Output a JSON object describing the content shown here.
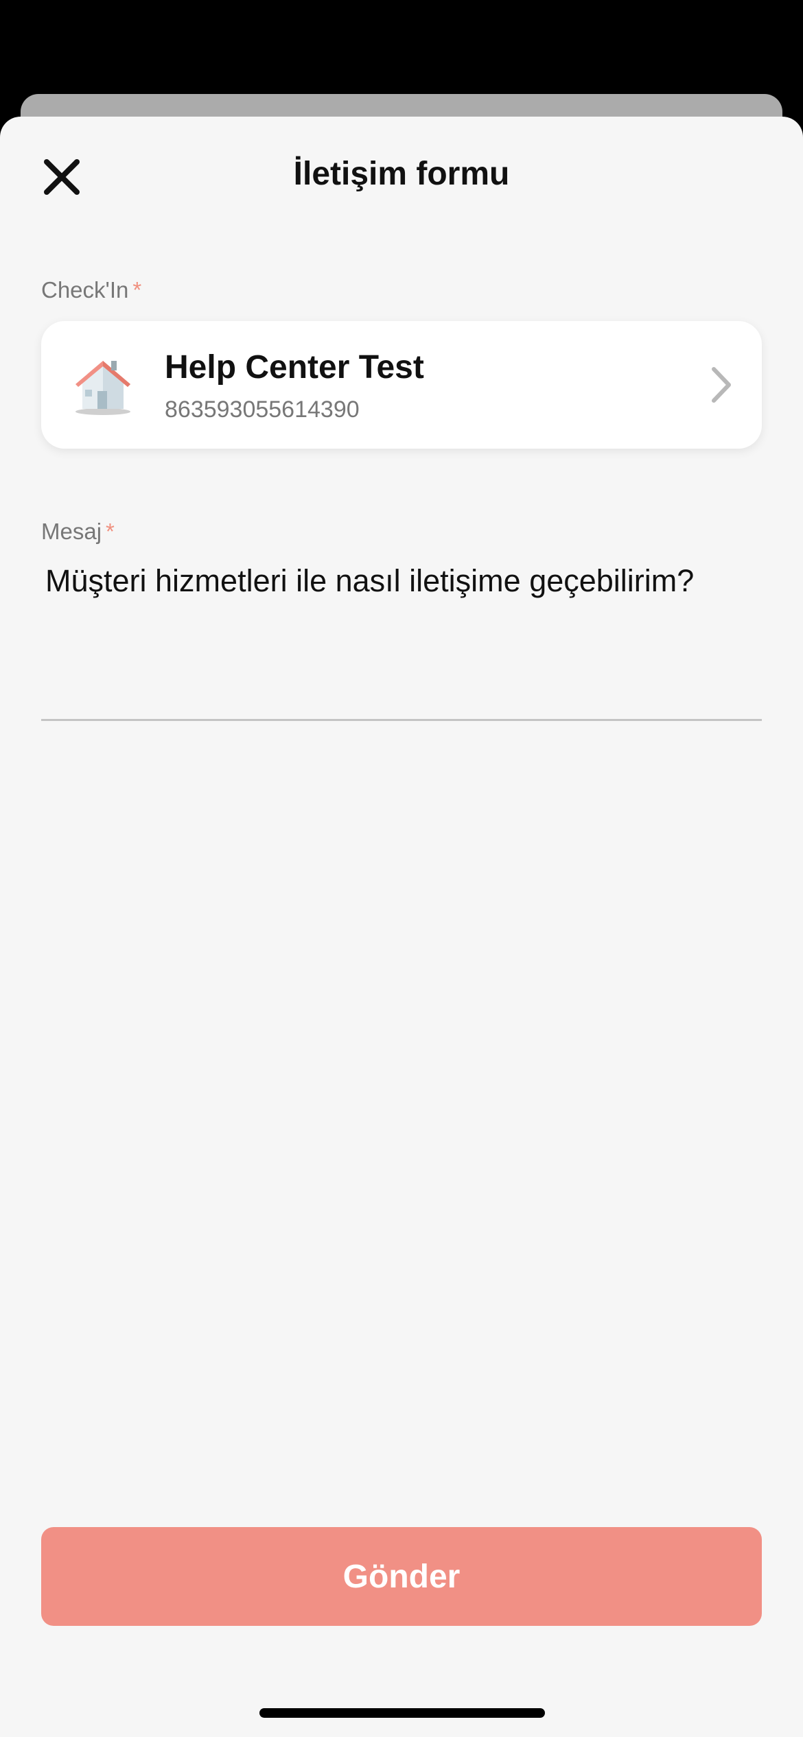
{
  "header": {
    "title": "İletişim formu",
    "close_icon": "close-icon"
  },
  "checkin": {
    "label": "Check'In",
    "required_mark": "*",
    "property_name": "Help Center Test",
    "property_id": "863593055614390",
    "icon": "house-icon",
    "chevron_icon": "chevron-right-icon"
  },
  "message": {
    "label": "Mesaj",
    "required_mark": "*",
    "value": "Müşteri hizmetleri ile nasıl iletişime geçebilirim?"
  },
  "submit": {
    "label": "Gönder"
  },
  "colors": {
    "accent": "#f19085",
    "required": "#f0907f",
    "sheet_background": "#f6f6f6",
    "card_background": "#ffffff"
  }
}
